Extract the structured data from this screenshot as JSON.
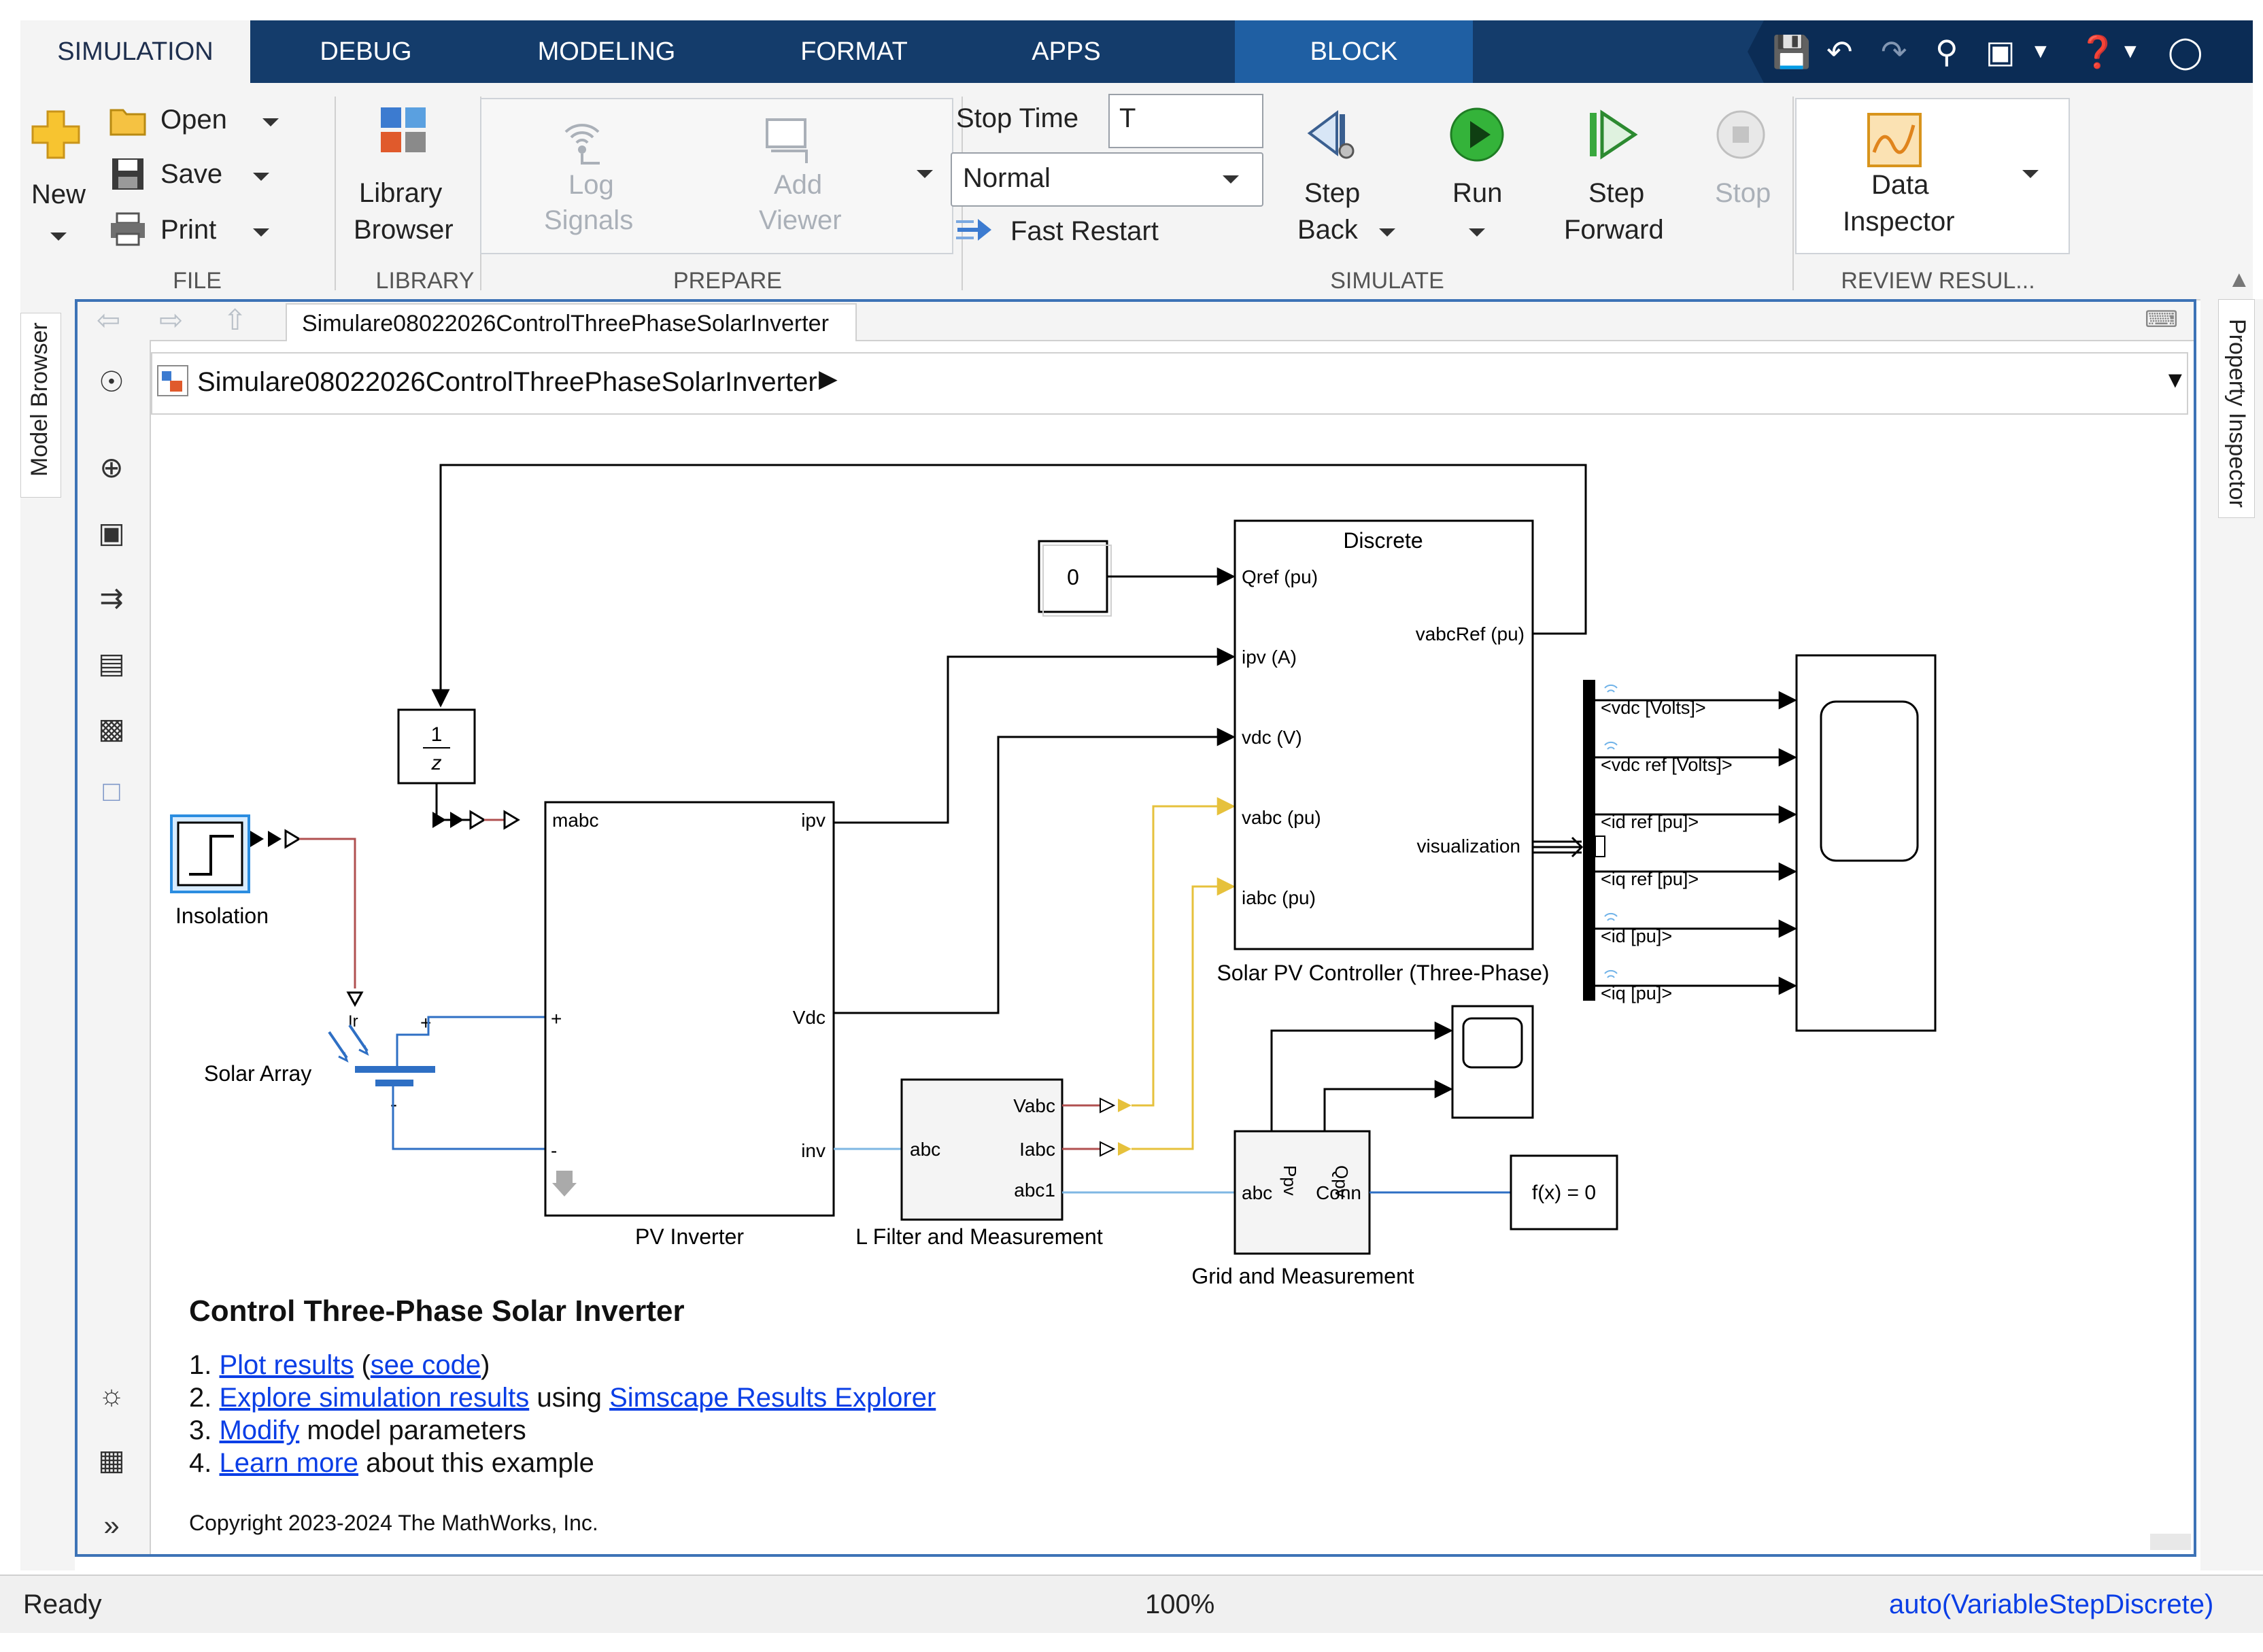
{
  "tabs": [
    {
      "label": "SIMULATION",
      "active": true
    },
    {
      "label": "DEBUG",
      "active": false
    },
    {
      "label": "MODELING",
      "active": false
    },
    {
      "label": "FORMAT",
      "active": false
    },
    {
      "label": "APPS",
      "active": false
    },
    {
      "label": "BLOCK",
      "active": false
    }
  ],
  "quick_access": [
    "save-icon",
    "undo-icon",
    "redo-icon",
    "find-icon",
    "window-icon",
    "dropdown-icon",
    "help-icon",
    "dropdown-icon",
    "collapse-icon"
  ],
  "ribbon": {
    "file": {
      "title": "FILE",
      "new_label": "New",
      "open_label": "Open",
      "save_label": "Save",
      "print_label": "Print"
    },
    "library": {
      "title": "LIBRARY",
      "library_browser_line1": "Library",
      "library_browser_line2": "Browser"
    },
    "prepare": {
      "title": "PREPARE",
      "log_signals_line1": "Log",
      "log_signals_line2": "Signals",
      "add_viewer_line1": "Add",
      "add_viewer_line2": "Viewer"
    },
    "simulate": {
      "title": "SIMULATE",
      "stop_time_label": "Stop Time",
      "stop_time_value": "T",
      "mode_value": "Normal",
      "fast_restart_label": "Fast Restart",
      "step_back_line1": "Step",
      "step_back_line2": "Back",
      "run_label": "Run",
      "step_forward_line1": "Step",
      "step_forward_line2": "Forward",
      "stop_label": "Stop"
    },
    "review": {
      "title": "REVIEW RESUL...",
      "data_inspector_line1": "Data",
      "data_inspector_line2": "Inspector"
    }
  },
  "side_panels": {
    "left": "Model Browser",
    "right": "Property Inspector"
  },
  "editor": {
    "model_tab": "Simulare08022026ControlThreePhaseSolarInverter",
    "breadcrumb": "Simulare08022026ControlThreePhaseSolarInverter"
  },
  "diagram": {
    "const_value": "0",
    "unit_delay_num": "1",
    "unit_delay_den": "z",
    "step_label": "Insolation",
    "solar_array_label": "Solar Array",
    "solar_array_port": "Ir",
    "pv_inverter": {
      "label": "PV Inverter",
      "in_mabc": "mabc",
      "in_plus": "+",
      "in_minus": "-",
      "out_ipv": "ipv",
      "out_vdc": "Vdc",
      "out_inv": "inv"
    },
    "controller": {
      "label": "Solar PV Controller (Three-Phase)",
      "header": "Discrete",
      "in_qref": "Qref (pu)",
      "in_ipv": "ipv (A)",
      "in_vdc": "vdc (V)",
      "in_vabc": "vabc (pu)",
      "in_iabc": "iabc (pu)",
      "out_vabcref": "vabcRef (pu)",
      "out_vis": "visualization"
    },
    "lfilter": {
      "label": "L Filter and Measurement",
      "in_abc": "abc",
      "out_vabc": "Vabc",
      "out_iabc": "Iabc",
      "out_abc1": "abc1"
    },
    "grid": {
      "label": "Grid and Measurement",
      "in_abc": "abc",
      "out_ppv": "Ppv",
      "out_qpv": "Qpv",
      "out_conn": "Conn"
    },
    "solver": "f(x) = 0",
    "bus_signals": [
      "<vdc [Volts]>",
      "<vdc ref [Volts]>",
      "<id ref [pu]>",
      "<iq ref [pu]>",
      "<id [pu]>",
      "<iq [pu]>"
    ]
  },
  "annotation": {
    "title": "Control Three-Phase Solar Inverter",
    "line1_prefix": "1. ",
    "line1_link": "Plot results",
    "line1_open": " (",
    "line1_link2": "see code",
    "line1_close": ")",
    "line2_prefix": "2. ",
    "line2_link": "Explore simulation results",
    "line2_mid": " using ",
    "line2_link2": "Simscape Results Explorer",
    "line3_prefix": "3. ",
    "line3_link": "Modify",
    "line3_suffix": " model parameters",
    "line4_prefix": "4. ",
    "line4_link": "Learn more",
    "line4_suffix": " about this example",
    "copyright": "Copyright 2023-2024 The MathWorks, Inc."
  },
  "status": {
    "left": "Ready",
    "zoom": "100%",
    "solver": "auto(VariableStepDiscrete)"
  },
  "colors": {
    "tab_bg": "#143c6b",
    "block_tab": "#1f5fa3",
    "signal_black": "#000000",
    "signal_yellow": "#e6c13c",
    "signal_red": "#b05050",
    "physical_blue": "#2e6fc4",
    "link": "#0a3ee6",
    "editor_border": "#3d73b6"
  }
}
